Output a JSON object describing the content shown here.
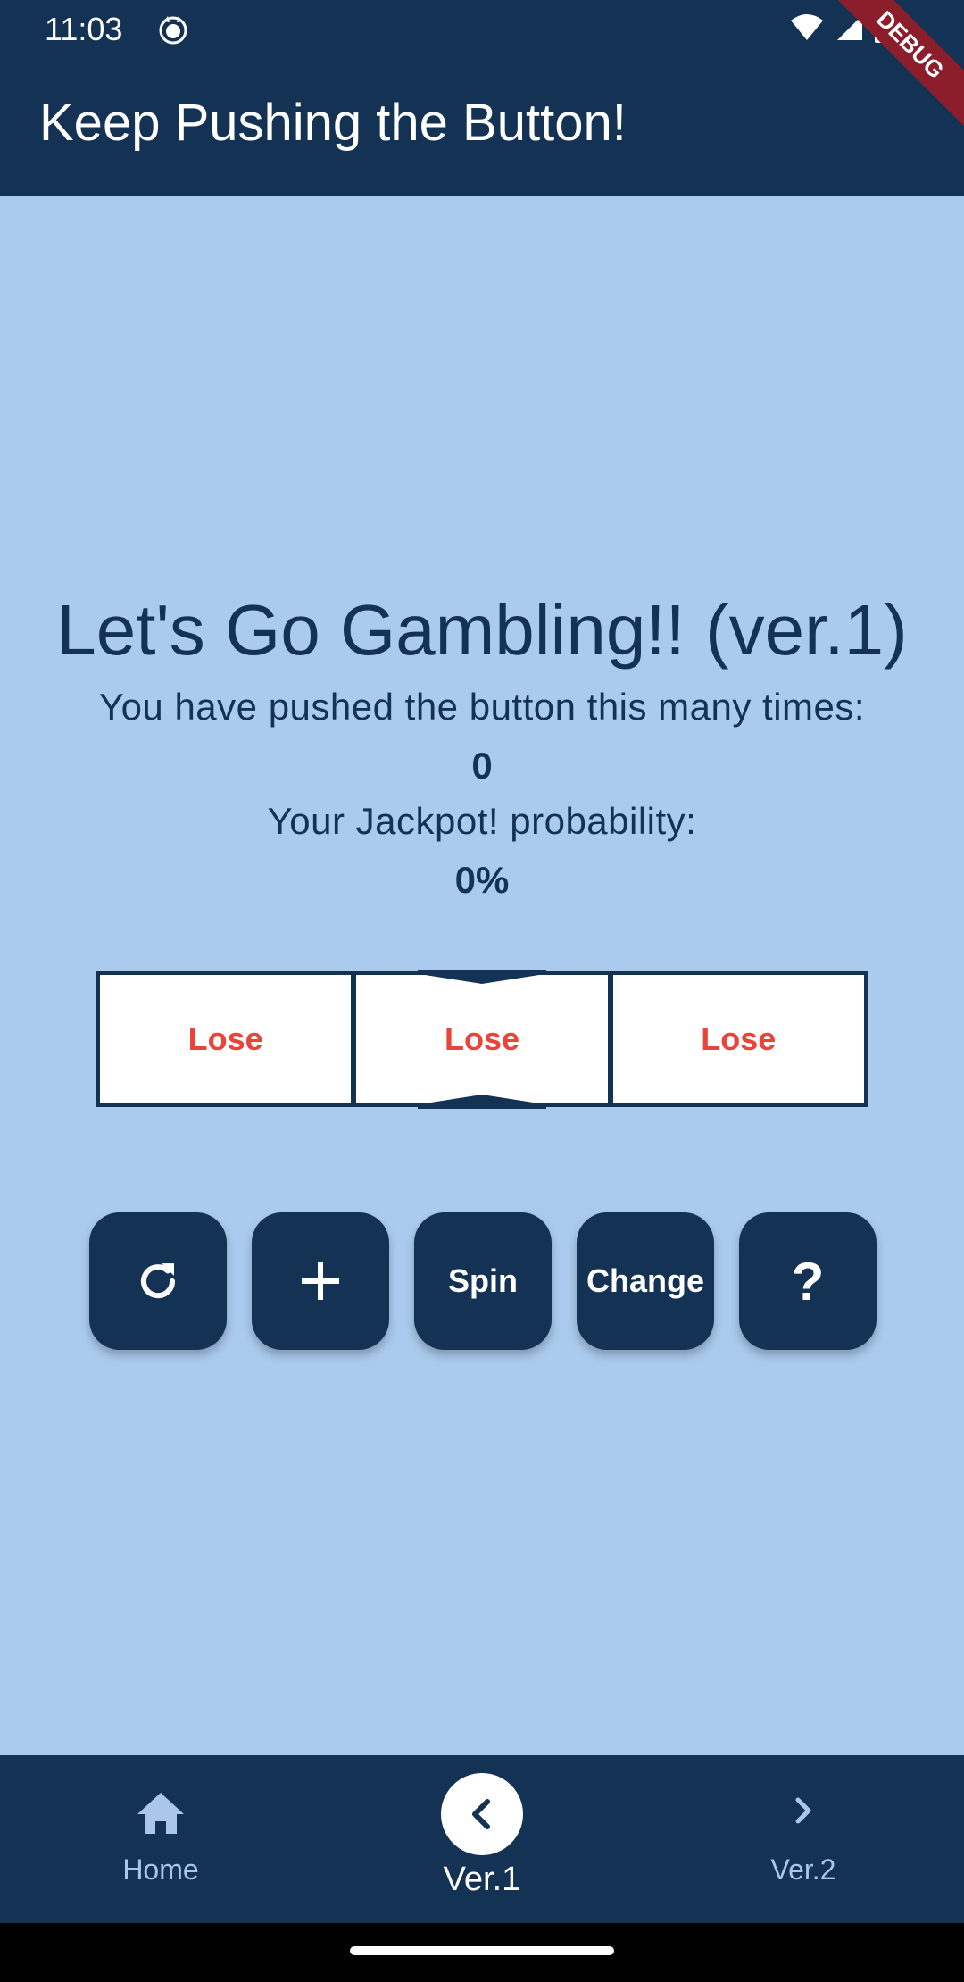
{
  "status": {
    "time": "11:03"
  },
  "debug_banner": "DEBUG",
  "appbar": {
    "title": "Keep Pushing the Button!"
  },
  "main": {
    "heading": "Let's Go Gambling!! (ver.1)",
    "pushed_label": "You have pushed the button this many times:",
    "push_count": "0",
    "probability_label": "Your Jackpot! probability:",
    "probability": "0%",
    "reels": [
      "Lose",
      "Lose",
      "Lose"
    ],
    "reel_text_color": "#e8443a"
  },
  "buttons": {
    "reset_icon": "refresh-icon",
    "add_icon": "plus-icon",
    "spin_label": "Spin",
    "change_label": "Change",
    "help_label": "?"
  },
  "bottom_nav": {
    "items": [
      {
        "label": "Home",
        "icon": "home-icon"
      },
      {
        "label": "Ver.1",
        "icon": "chevron-left-icon",
        "selected": true
      },
      {
        "label": "Ver.2",
        "icon": "chevron-right-icon"
      }
    ]
  },
  "colors": {
    "primary": "#143253",
    "background": "#abcbee",
    "lose": "#e8443a"
  }
}
